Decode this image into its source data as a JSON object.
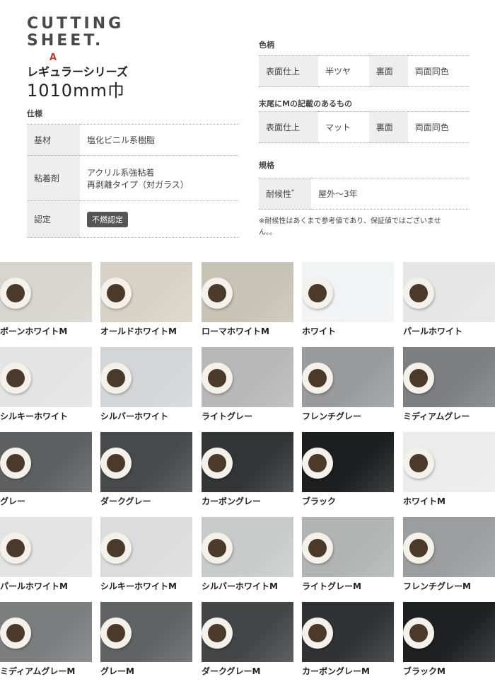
{
  "brand": {
    "line1": "CUTTING",
    "line2": "SHEET.",
    "mark": "A"
  },
  "series": "レギュラーシリーズ",
  "width": "1010mm巾",
  "spec": {
    "title": "仕様",
    "rows": [
      {
        "head": "基材",
        "value1": "塩化ビニル系樹脂",
        "value2": ""
      },
      {
        "head": "粘着剤",
        "value1": "アクリル系強粘着",
        "value2": "再剥離タイプ（対ガラス）"
      },
      {
        "head": "認定",
        "badge": "不燃認定"
      }
    ]
  },
  "color": {
    "title": "色柄",
    "row": {
      "h1": "表面仕上",
      "v1": "半ツヤ",
      "h2": "裏面",
      "v2": "両面同色"
    }
  },
  "m_color": {
    "title": "末尾にMの記載のあるもの",
    "row": {
      "h1": "表面仕上",
      "v1": "マット",
      "h2": "裏面",
      "v2": "両面同色"
    }
  },
  "standard": {
    "title": "規格",
    "row": {
      "h1": "耐候性",
      "sup": "*",
      "v1": "屋外～3年"
    }
  },
  "note": "※耐候性はあくまで参考値であり、保証値ではございません。。",
  "swatches": [
    {
      "name": "ボーンホワイトM",
      "color": "#d6d5d0"
    },
    {
      "name": "オールドホワイトM",
      "color": "#d8d3c6"
    },
    {
      "name": "ローマホワイトM",
      "color": "#c7c3b5"
    },
    {
      "name": "ホワイト",
      "color": "#f2f3f5"
    },
    {
      "name": "パールホワイト",
      "color": "#e6e6e6"
    },
    {
      "name": "シルキーホワイト",
      "color": "#e4e4e4"
    },
    {
      "name": "シルバーホワイト",
      "color": "#d4d5d6"
    },
    {
      "name": "ライトグレー",
      "color": "#b8b8b8"
    },
    {
      "name": "フレンチグレー",
      "color": "#9a9b9c"
    },
    {
      "name": "ミディアムグレー",
      "color": "#7d7e7f"
    },
    {
      "name": "グレー",
      "color": "#5e5f61"
    },
    {
      "name": "ダークグレー",
      "color": "#48494b"
    },
    {
      "name": "カーボングレー",
      "color": "#323436"
    },
    {
      "name": "ブラック",
      "color": "#1d1e20"
    },
    {
      "name": "ホワイトM",
      "color": "#ececec"
    },
    {
      "name": "パールホワイトM",
      "color": "#e3e3e3"
    },
    {
      "name": "シルキーホワイトM",
      "color": "#dcdcdc"
    },
    {
      "name": "シルバーホワイトM",
      "color": "#c9caca"
    },
    {
      "name": "ライトグレーM",
      "color": "#b2b3b3"
    },
    {
      "name": "フレンチグレーM",
      "color": "#9c9d9e"
    },
    {
      "name": "ミディアムグレーM",
      "color": "#7c7d7e"
    },
    {
      "name": "グレーM",
      "color": "#616264"
    },
    {
      "name": "ダークグレーM",
      "color": "#444547"
    },
    {
      "name": "カーボングレーM",
      "color": "#313235"
    },
    {
      "name": "ブラックM",
      "color": "#1f2022"
    }
  ]
}
